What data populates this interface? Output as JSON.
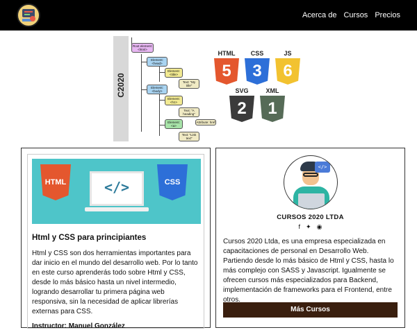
{
  "nav": {
    "logo_icon": "code-laptop-logo",
    "links": [
      "Acerca de",
      "Cursos",
      "Precios"
    ]
  },
  "hero": {
    "vertical_text": "C2020",
    "vertical_subtext": "CURSOS 2020 LTDA",
    "tree_nodes": [
      "Root element: <html>",
      "Element: <head>",
      "Element: <title>",
      "Text: \"My title\"",
      "Element: <body>",
      "Element: <h1>",
      "Text: \"A heading\"",
      "Element: <a>",
      "Attribute: href",
      "Text: \"Link text\""
    ],
    "badges": [
      {
        "label": "HTML",
        "num": "5",
        "color": "#e4572e"
      },
      {
        "label": "CSS",
        "num": "3",
        "color": "#2d6fd8"
      },
      {
        "label": "JS",
        "num": "6",
        "color": "#f2c230"
      },
      {
        "label": "SVG",
        "num": "2",
        "color": "#3b3b3b"
      },
      {
        "label": "XML",
        "num": "1",
        "color": "#566b57"
      }
    ]
  },
  "course": {
    "banner_left": "HTML",
    "banner_right": "CSS",
    "banner_code": "</>",
    "title": "Html y CSS para principiantes",
    "description": "Html y CSS son dos herramientas importantes para dar inicio en el mundo del desarrollo web. Por lo tanto en este curso aprenderás todo sobre Html y CSS, desde lo más básico hasta un nivel intermedio, logrando desarrollar tu primera página web responsiva, sin la necesidad de aplicar librerías externas para CSS.",
    "instructor": "Instructor: Manuel González"
  },
  "company": {
    "name": "CURSOS 2020 LTDA",
    "socials": [
      "facebook-icon",
      "twitter-icon",
      "github-icon"
    ],
    "about": "Cursos 2020 Ltda, es una empresa especializada en capacitaciones de personal en Desarrollo Web. Partiendo desde lo más básico de Html y CSS, hasta lo más complejo con SASS y Javascript. Igualmente se ofrecen cursos más especializados para Backend, implementación de frameworks para el Frontend, entre otros.",
    "button": "Más Cursos",
    "button_color": "#3a1f0f"
  }
}
